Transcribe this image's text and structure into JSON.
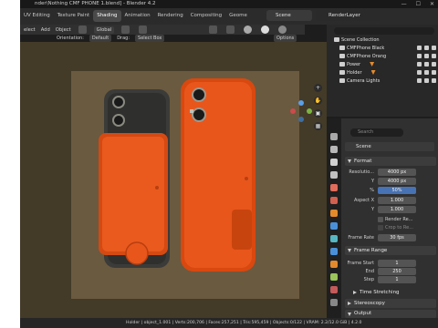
{
  "window": {
    "title": "nder\\Nothing CMF PHONE 1.blend] - Blender 4.2",
    "controls": [
      "—",
      "☐",
      "✕"
    ]
  },
  "workspace_tabs": [
    "UV Editing",
    "Texture Paint",
    "Shading",
    "Animation",
    "Rendering",
    "Compositing",
    "Geome"
  ],
  "active_tab": "Shading",
  "scene_selector": "Scene",
  "view_layer": "RenderLayer",
  "viewport_header": {
    "menu": [
      "elect",
      "Add",
      "Object"
    ],
    "transform_orientation": "Global",
    "orientation_label": "Orientation:",
    "orientation_value": "Default",
    "drag_label": "Drag:",
    "drag_value": "Select Box",
    "options": "Options"
  },
  "outliner": {
    "title": "Scene Collection",
    "items": [
      {
        "label": "CMFPhone Black",
        "icon": "collection-icon"
      },
      {
        "label": "CMFPhone Orang",
        "icon": "collection-icon"
      },
      {
        "label": "Power",
        "icon": "light-icon"
      },
      {
        "label": "Holder",
        "icon": "light-icon"
      },
      {
        "label": "Camera Lights",
        "icon": "camera-icon"
      }
    ]
  },
  "properties": {
    "search_placeholder": "Search",
    "context": "Scene",
    "format": {
      "header": "Format",
      "resolution_label": "Resolutio...",
      "res_x": "4000 px",
      "y_label": "Y",
      "res_y": "4000 px",
      "pct_label": "%",
      "res_pct": "50%",
      "aspect_label": "Aspect X",
      "aspect_x": "1.000",
      "aspect_y": "1.000",
      "render_region": "Render Re...",
      "crop": "Crop to Re...",
      "frame_rate_label": "Frame Rate",
      "frame_rate": "30 fps"
    },
    "frame_range": {
      "header": "Frame Range",
      "start_label": "Frame Start",
      "start": "1",
      "end_label": "End",
      "end": "250",
      "step_label": "Step",
      "step": "1"
    },
    "time_stretching": "Time Stretching",
    "stereoscopy": "Stereoscopy",
    "output": "Output"
  },
  "status_bar": "Holder | object_1.001 | Verts:200,706 | Faces:257,251 | Tris:595,459 | Objects:0/122 | VRAM: 2.2/12.0 GiB | 4.2.0",
  "colors": {
    "orange_phone": "#e8561c",
    "black_phone": "#3a3a38",
    "viewport_bg": "#433a28",
    "camera_frame": "#6a5a40"
  }
}
